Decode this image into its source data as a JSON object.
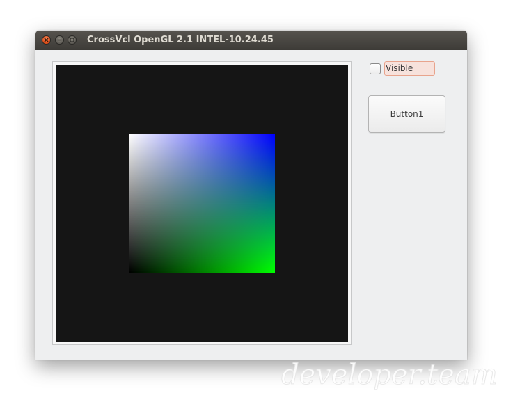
{
  "window": {
    "title": "CrossVcl OpenGL 2.1 INTEL-10.24.45"
  },
  "gl_view": {
    "background_color": "#151515",
    "gradient_colors": {
      "top_left": "#ffffff",
      "top_right": "#0000ff",
      "bottom_left": "#000000",
      "bottom_right": "#00ff00"
    }
  },
  "controls": {
    "visible_checkbox": {
      "label": "Visible",
      "checked": false
    },
    "button1_label": "Button1"
  },
  "watermark": {
    "text": "developer.team"
  },
  "icons": {
    "close": "close-icon",
    "minimize": "minimize-icon",
    "maximize": "maximize-icon"
  }
}
